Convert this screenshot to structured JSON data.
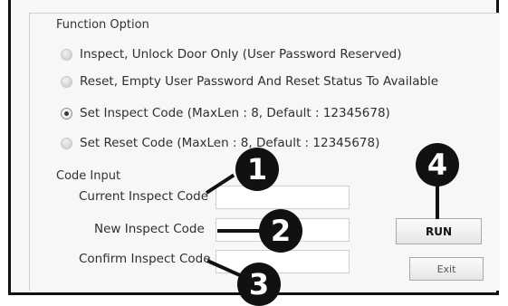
{
  "function_option": {
    "title": "Function Option",
    "options": [
      {
        "label": "Inspect, Unlock Door Only (User Password Reserved)",
        "checked": false
      },
      {
        "label": "Reset, Empty User Password And Reset Status To Available",
        "checked": false
      },
      {
        "label": "Set Inspect Code (MaxLen : 8, Default : 12345678)",
        "checked": true
      },
      {
        "label": "Set Reset Code (MaxLen : 8, Default : 12345678)",
        "checked": false
      }
    ]
  },
  "code_input": {
    "title": "Code Input",
    "current_label": "Current Inspect Code",
    "new_label": "New Inspect Code",
    "confirm_label": "Confirm Inspect Code",
    "current_value": "",
    "new_value": "",
    "confirm_value": ""
  },
  "buttons": {
    "run": "RUN",
    "exit": "Exit"
  },
  "callouts": [
    "1",
    "2",
    "3",
    "4"
  ],
  "colors": {
    "callout": "#111111",
    "panel": "#f7f7f7"
  }
}
